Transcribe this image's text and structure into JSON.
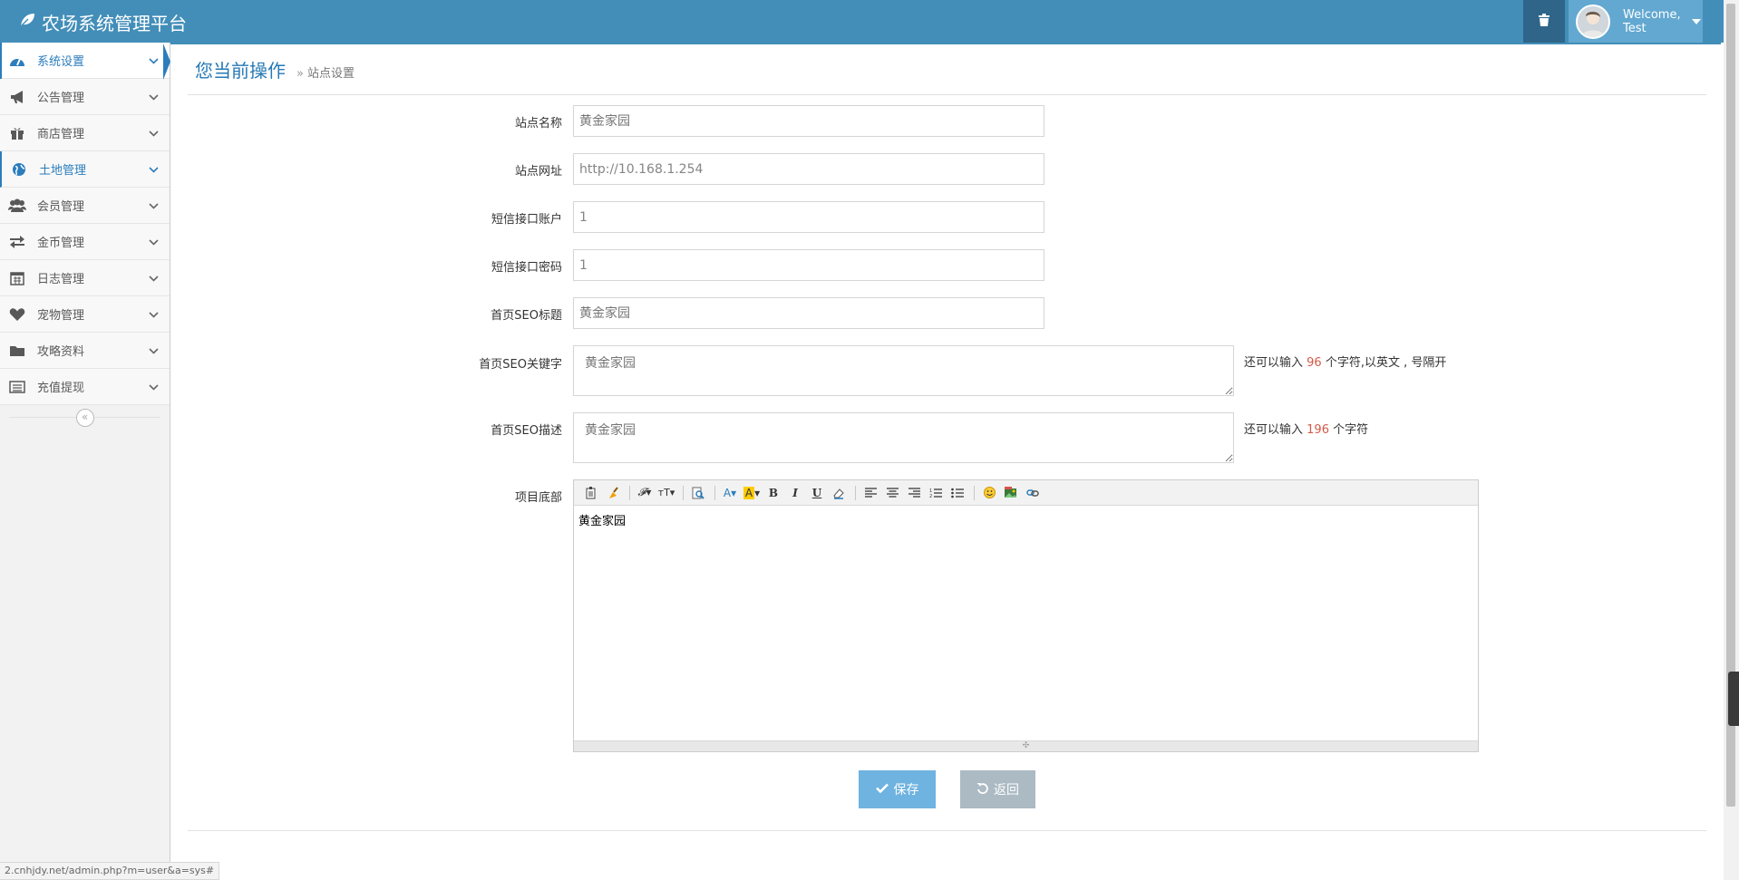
{
  "header": {
    "app_title": "农场系统管理平台",
    "welcome": "Welcome,",
    "username": "Test",
    "brand_color": "#438eb9"
  },
  "sidebar": {
    "items": [
      {
        "label": "系统设置",
        "icon": "dashboard-icon"
      },
      {
        "label": "公告管理",
        "icon": "bullhorn-icon"
      },
      {
        "label": "商店管理",
        "icon": "gift-icon"
      },
      {
        "label": "土地管理",
        "icon": "globe-icon"
      },
      {
        "label": "会员管理",
        "icon": "users-icon"
      },
      {
        "label": "金币管理",
        "icon": "exchange-icon"
      },
      {
        "label": "日志管理",
        "icon": "calendar-icon"
      },
      {
        "label": "宠物管理",
        "icon": "heart-icon"
      },
      {
        "label": "攻略资料",
        "icon": "folder-icon"
      },
      {
        "label": "充值提现",
        "icon": "list-icon"
      }
    ],
    "collapse_glyph": "«"
  },
  "breadcrumb": {
    "title": "您当前操作",
    "arrow": "»",
    "current": "站点设置"
  },
  "form": {
    "site_name": {
      "label": "站点名称",
      "placeholder": "黄金家园"
    },
    "site_url": {
      "label": "站点网址",
      "value": "http://10.168.1.254"
    },
    "sms_account": {
      "label": "短信接口账户",
      "value": "1"
    },
    "sms_password": {
      "label": "短信接口密码",
      "value": "1"
    },
    "seo_title": {
      "label": "首页SEO标题",
      "placeholder": "黄金家园"
    },
    "seo_keywords": {
      "label": "首页SEO关键字",
      "placeholder": "黄金家园",
      "hint_prefix": "还可以输入",
      "hint_count": "96",
      "hint_suffix": "个字符,以英文 , 号隔开"
    },
    "seo_description": {
      "label": "首页SEO描述",
      "placeholder": "黄金家园",
      "hint_prefix": "还可以输入",
      "hint_count": "196",
      "hint_suffix": "个字符"
    },
    "footer": {
      "label": "项目底部",
      "content": "黄金家园"
    }
  },
  "editor_toolbar": [
    "paste-icon",
    "clear-format-icon",
    "font-family-icon",
    "font-size-icon",
    "preview-icon",
    "font-color-icon",
    "highlight-icon",
    "bold-icon",
    "italic-icon",
    "underline-icon",
    "eraser-icon",
    "align-left-icon",
    "align-center-icon",
    "align-right-icon",
    "ordered-list-icon",
    "unordered-list-icon",
    "emoticon-icon",
    "image-icon",
    "link-icon"
  ],
  "buttons": {
    "save": "保存",
    "back": "返回"
  },
  "status_url": "2.cnhjdy.net/admin.php?m=user&a=sys#"
}
